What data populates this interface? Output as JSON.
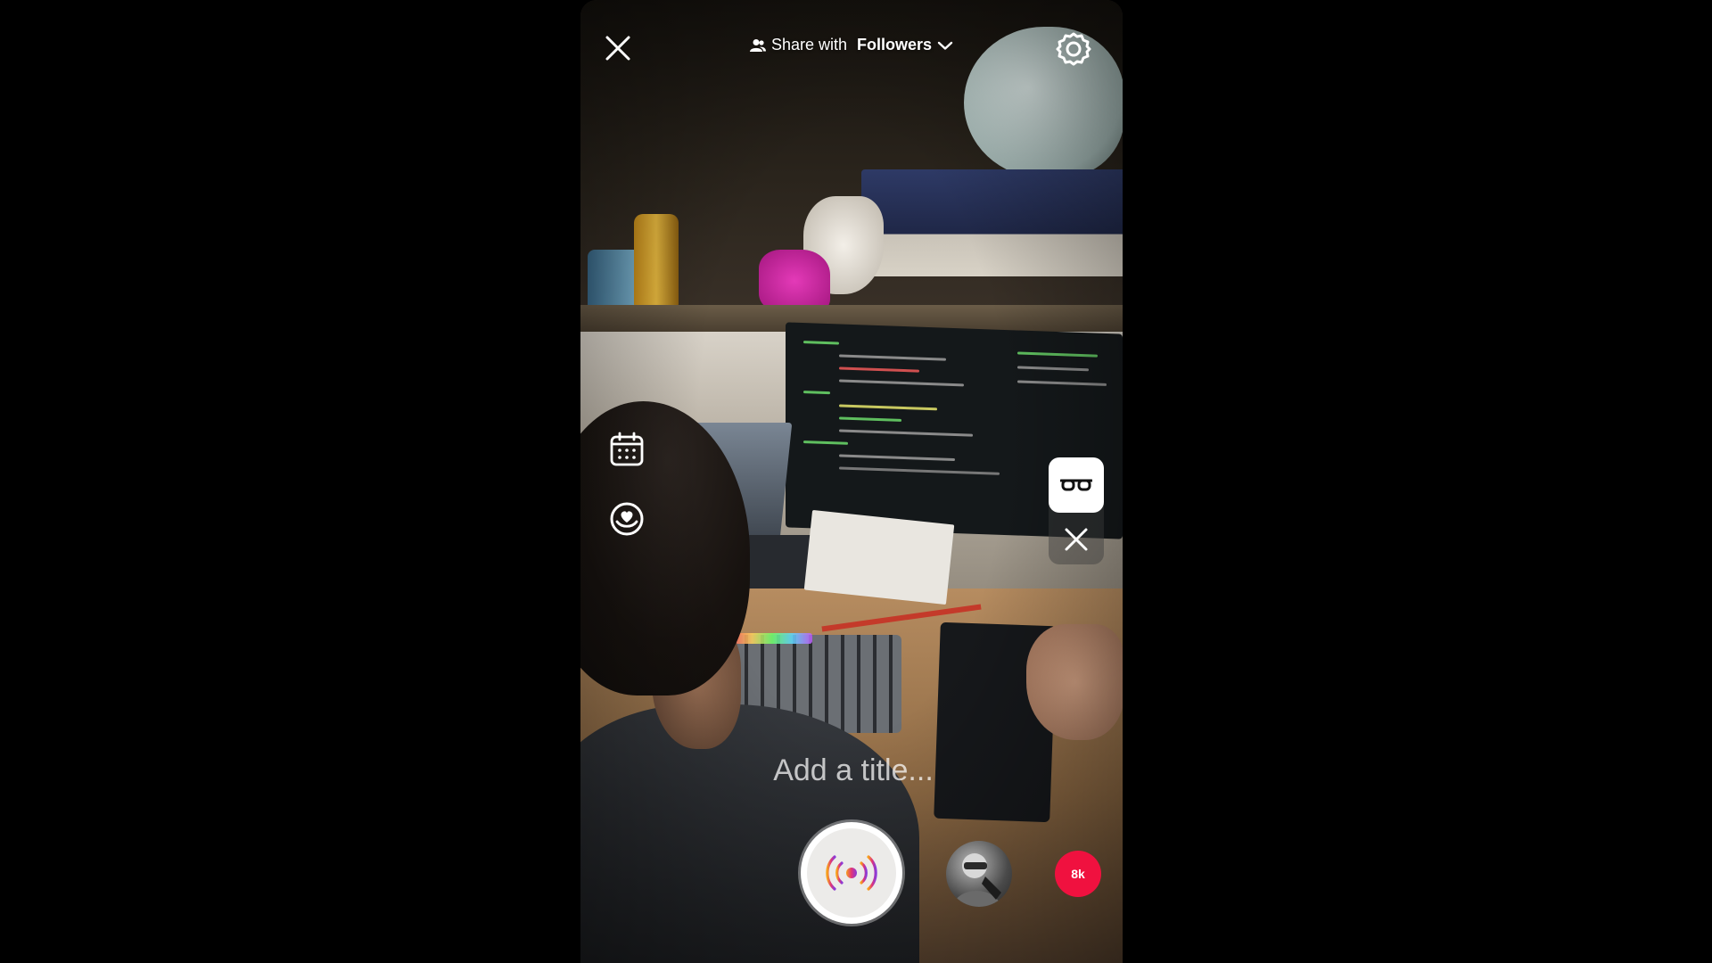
{
  "top_bar": {
    "close_icon": "close-icon",
    "share_prefix": "Share with ",
    "share_audience": "Followers",
    "audience_icon": "people-icon",
    "dropdown_icon": "chevron-down-icon",
    "settings_icon": "gear-icon"
  },
  "side_tools": [
    {
      "icon": "calendar-icon"
    },
    {
      "icon": "heart-badge-icon"
    }
  ],
  "effects": {
    "active_icon": "glasses-icon",
    "remove_icon": "close-icon"
  },
  "title_field": {
    "placeholder": "Add a title...",
    "value": ""
  },
  "bottom_bar": {
    "go_live_icon": "live-broadcast-icon",
    "avatar_icon": "avatar",
    "viewer_badge": "8k"
  },
  "colors": {
    "badge": "#f0113f",
    "live_gradient_start": "#f7a21b",
    "live_gradient_mid": "#e0347a",
    "live_gradient_end": "#8a3ad8"
  }
}
